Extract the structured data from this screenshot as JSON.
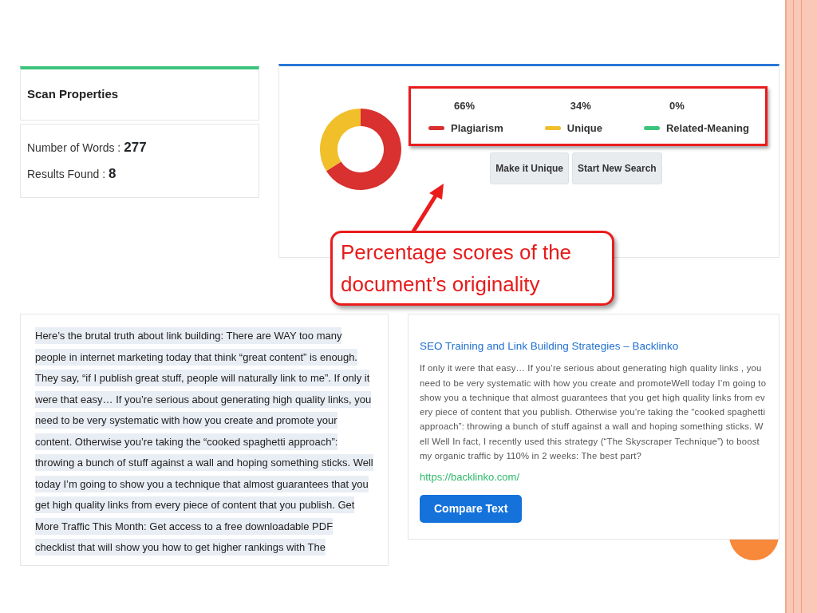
{
  "scan_properties": {
    "title": "Scan Properties",
    "stats": [
      {
        "label": "Number of Words :",
        "value": "277"
      },
      {
        "label": "Results Found :",
        "value": "8"
      }
    ]
  },
  "scores": {
    "chart_data": {
      "type": "donut",
      "categories": [
        "Plagiarism",
        "Unique",
        "Related-Meaning"
      ],
      "values": [
        66,
        34,
        0
      ]
    },
    "legend": [
      {
        "value": "66%",
        "color": "#d93030"
      },
      {
        "value": "34%",
        "color": "#f0bf2a"
      },
      {
        "value": "0%",
        "color": "#3cc47c"
      }
    ],
    "buttons": [
      "Make it Unique",
      "Start New Search"
    ]
  },
  "callout": {
    "text": "Percentage scores of the document’s originality"
  },
  "source_text": "Here’s the brutal truth about link building: There are WAY too many people in internet marketing today that think “great content” is enough. They say, “if I publish great stuff, people will naturally link to me”.  If only it were that easy… If you’re serious about generating high quality links, you need to be very systematic with how you create and promote your content.  Otherwise you’re taking the “cooked spaghetti approach”: throwing a bunch of stuff against a wall and hoping something sticks. Well today I’m going to show you a technique that almost guarantees that you get high quality links from every piece of content that you publish.  Get More Traffic This Month: Get access to a free downloadable PDF checklist that will show you how to get higher rankings with The",
  "result": {
    "title": "SEO Training and Link Building Strategies – Backlinko",
    "snippet": "If only it were that easy… If you’re serious about generating high quality links , you need to be very systematic with how you create and promoteWell today I’m going to show you a technique that almost guarantees that you get high quality links from every piece of content that you publish. Otherwise you’re taking the “cooked spaghetti approach”: throwing a bunch of stuff against a wall and hoping something sticks. Well Well In fact, I recently used this strategy (“The Skyscraper Technique”) to boost my organic traffic by 110% in 2 weeks: The best part?",
    "url": "https://backlinko.com/",
    "button": "Compare Text"
  }
}
